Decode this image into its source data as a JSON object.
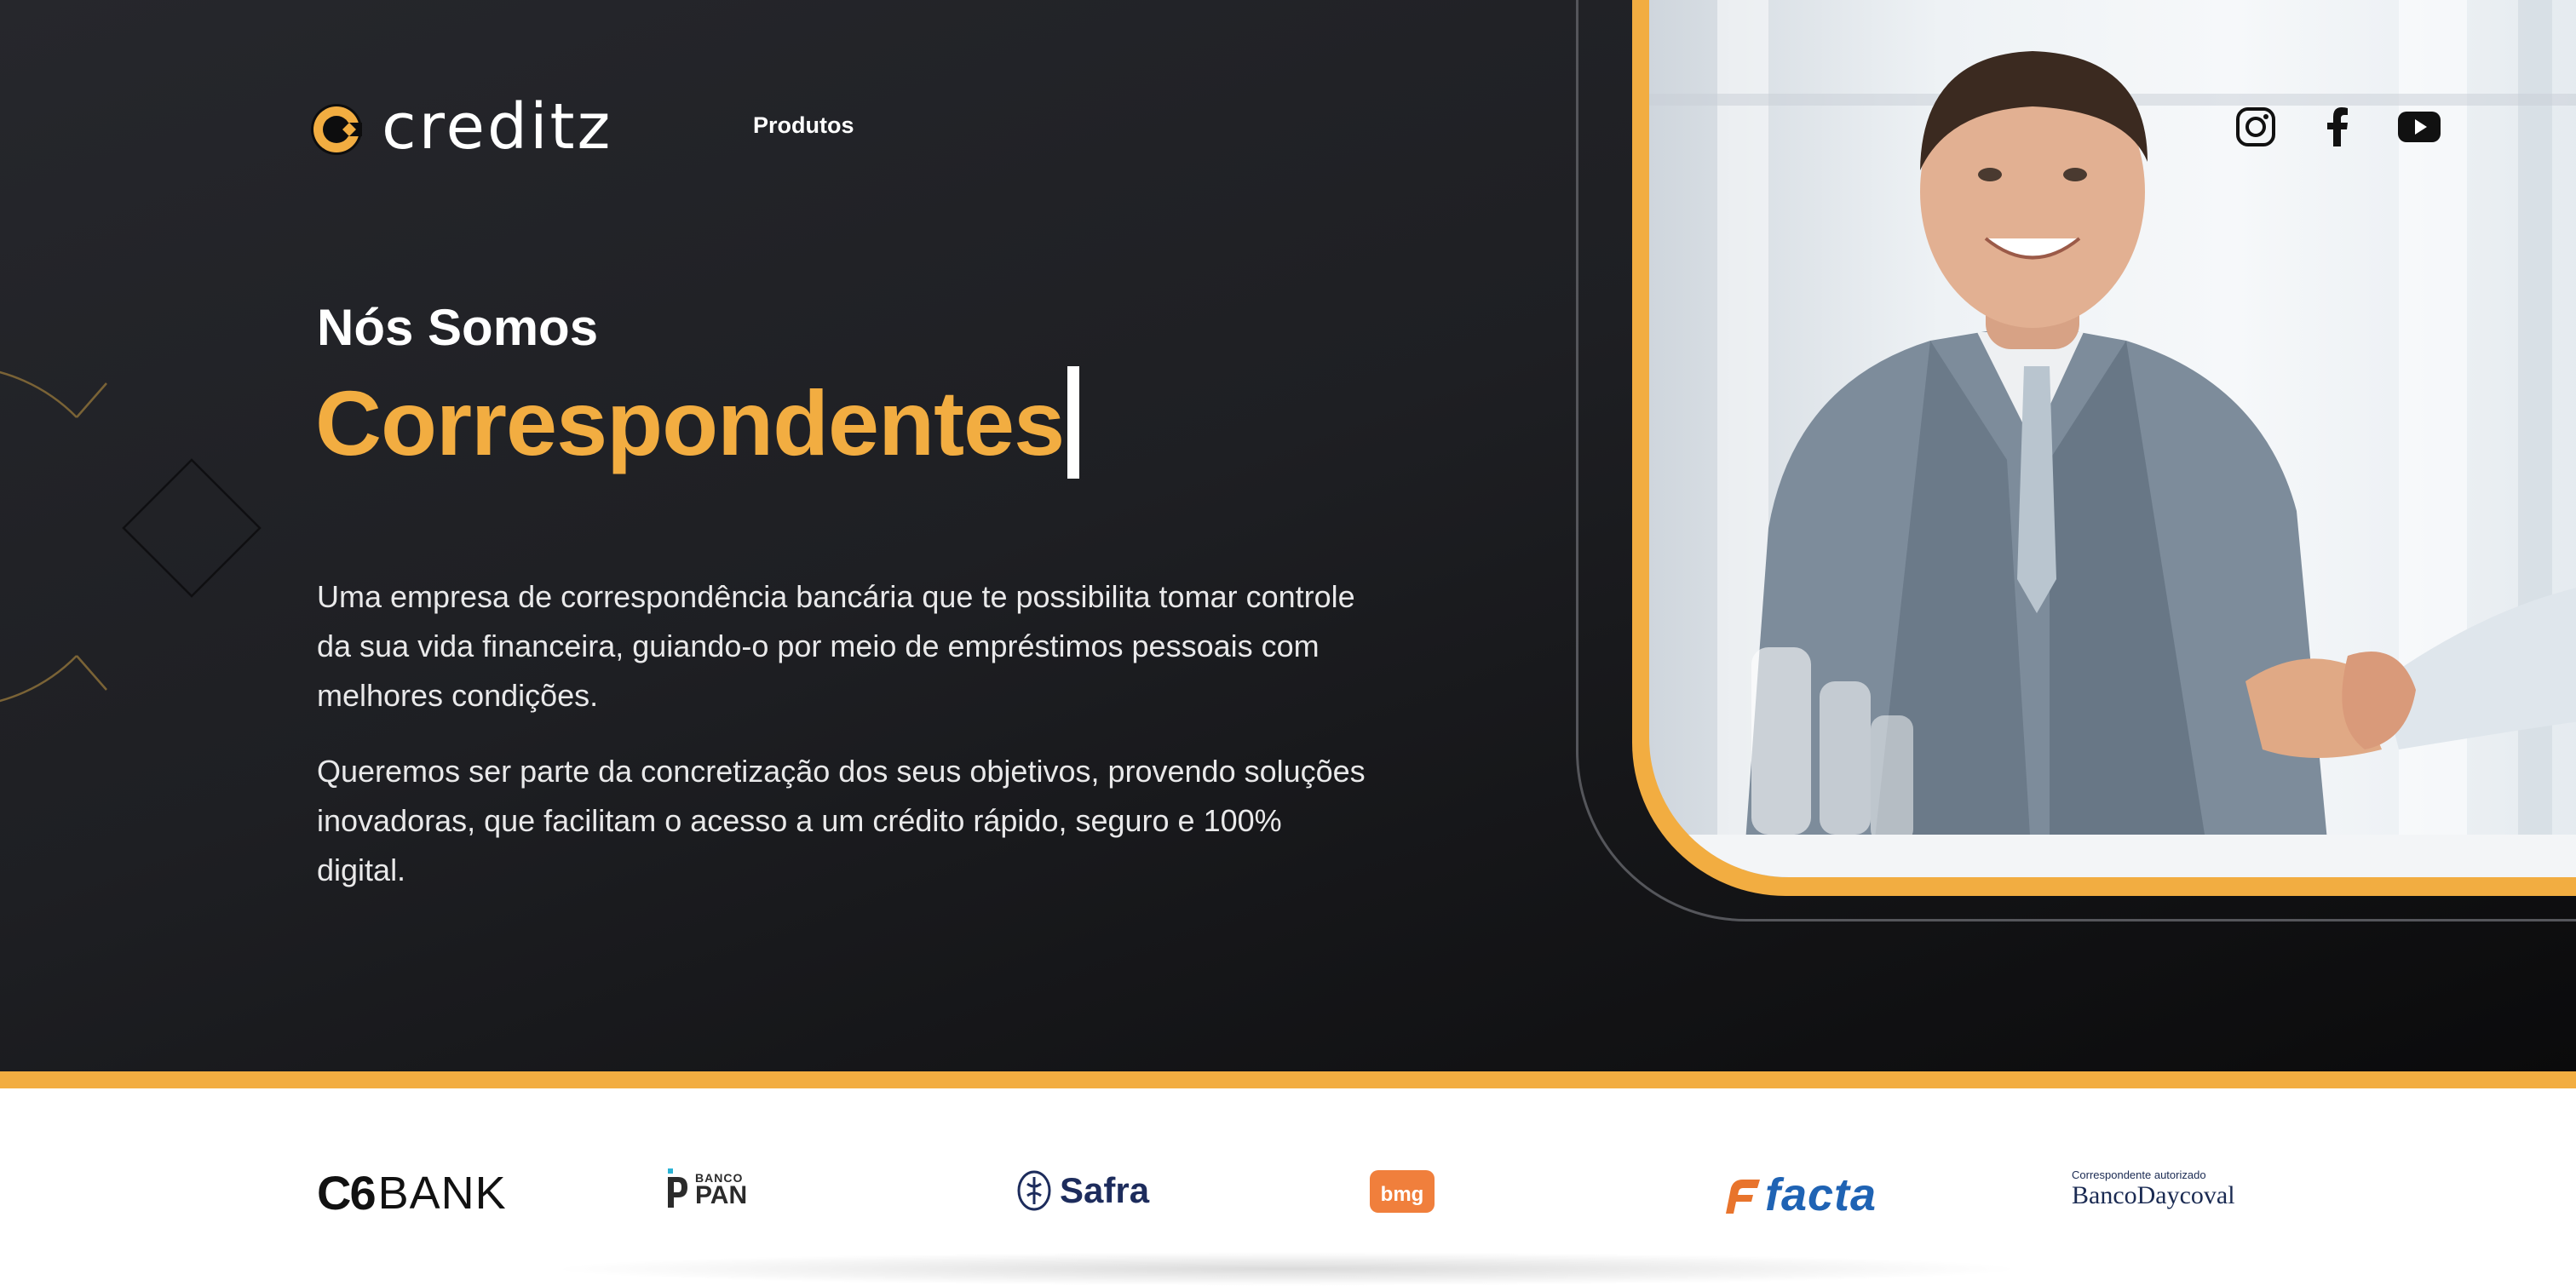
{
  "brand": {
    "name": "creditz",
    "accent": "#f2ad41",
    "background": "#1e1f23"
  },
  "nav": {
    "produtos": "Produtos"
  },
  "hero": {
    "headline_small": "Nós Somos",
    "headline_big": "Correspondentes",
    "paragraph1": "Uma empresa de correspondência bancária que te possibilita tomar controle da sua vida financeira, guiando-o por meio de empréstimos pessoais com melhores condições.",
    "paragraph2": "Queremos ser parte da concretização dos seus objetivos, provendo soluções inovadoras, que facilitam o acesso a um crédito rápido, seguro e 100% digital."
  },
  "social": [
    "instagram-icon",
    "facebook-icon",
    "youtube-icon"
  ],
  "banks": {
    "c6": {
      "bold": "C6",
      "light": "BANK"
    },
    "pan": {
      "small": "BANCO",
      "big": "PAN"
    },
    "safra": "Safra",
    "bmg": "bmg",
    "facta": "facta",
    "daycoval": {
      "caption": "Correspondente autorizado",
      "prefix": "Banco",
      "name": "Daycoval"
    }
  }
}
